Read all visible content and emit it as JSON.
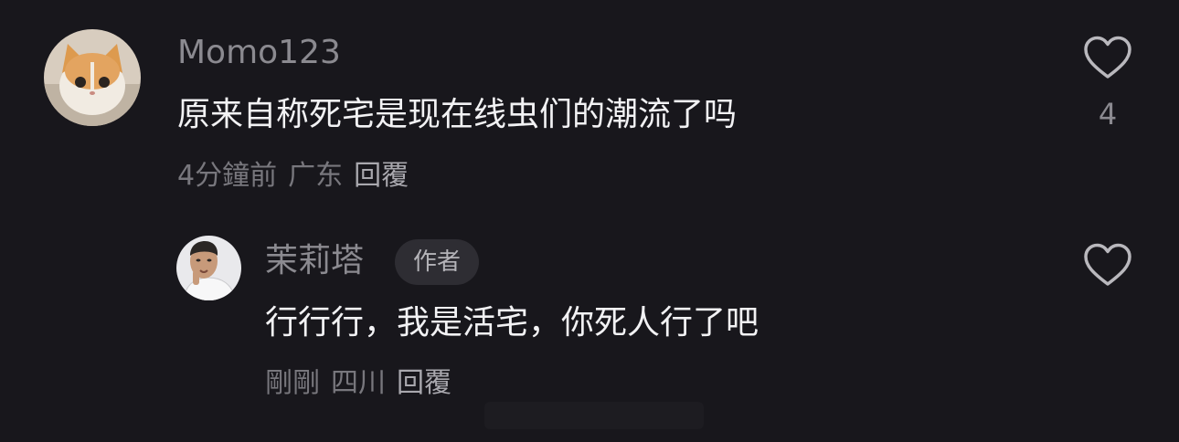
{
  "comment": {
    "username": "Momo123",
    "text": "原来自称死宅是现在线虫们的潮流了吗",
    "time": "4分鐘前",
    "location": "广东",
    "reply_label": "回覆",
    "like_count": "4",
    "avatar_icon": "kitten-avatar"
  },
  "reply": {
    "username": "茉莉塔",
    "badge": "作者",
    "text": "行行行，我是活宅，你死人行了吧",
    "time": "剛剛",
    "location": "四川",
    "reply_label": "回覆",
    "avatar_icon": "person-avatar"
  },
  "icons": {
    "like": "heart-outline-icon"
  },
  "colors": {
    "background": "#18171c",
    "text_primary": "#f2f2f4",
    "text_secondary": "#8b8a90",
    "badge_bg": "#2e2d33"
  }
}
